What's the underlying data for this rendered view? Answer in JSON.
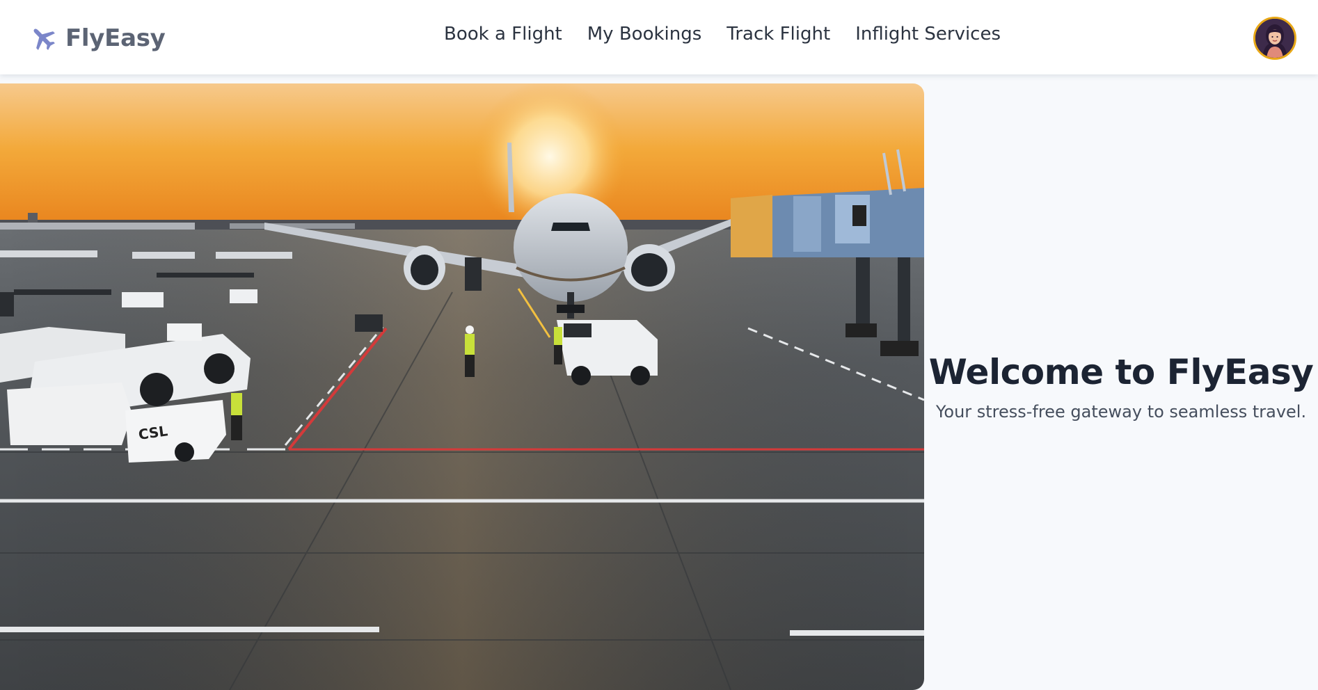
{
  "brand": {
    "name": "FlyEasy",
    "icon": "airplane-icon",
    "icon_color": "#7b86c9"
  },
  "nav": {
    "items": [
      {
        "label": "Book a Flight"
      },
      {
        "label": "My Bookings"
      },
      {
        "label": "Track Flight"
      },
      {
        "label": "Inflight Services"
      }
    ]
  },
  "user": {
    "avatar_icon": "user-avatar-icon",
    "ring_color": "#e8a817"
  },
  "hero": {
    "image_subject": "airport-apron-sunset-photo"
  },
  "welcome": {
    "title": "Welcome to FlyEasy",
    "subtitle": "Your stress-free gateway to seamless travel."
  },
  "colors": {
    "background": "#f7f9fc",
    "header_bg": "#ffffff",
    "title_text": "#1c2433",
    "nav_text": "#2b3340"
  }
}
